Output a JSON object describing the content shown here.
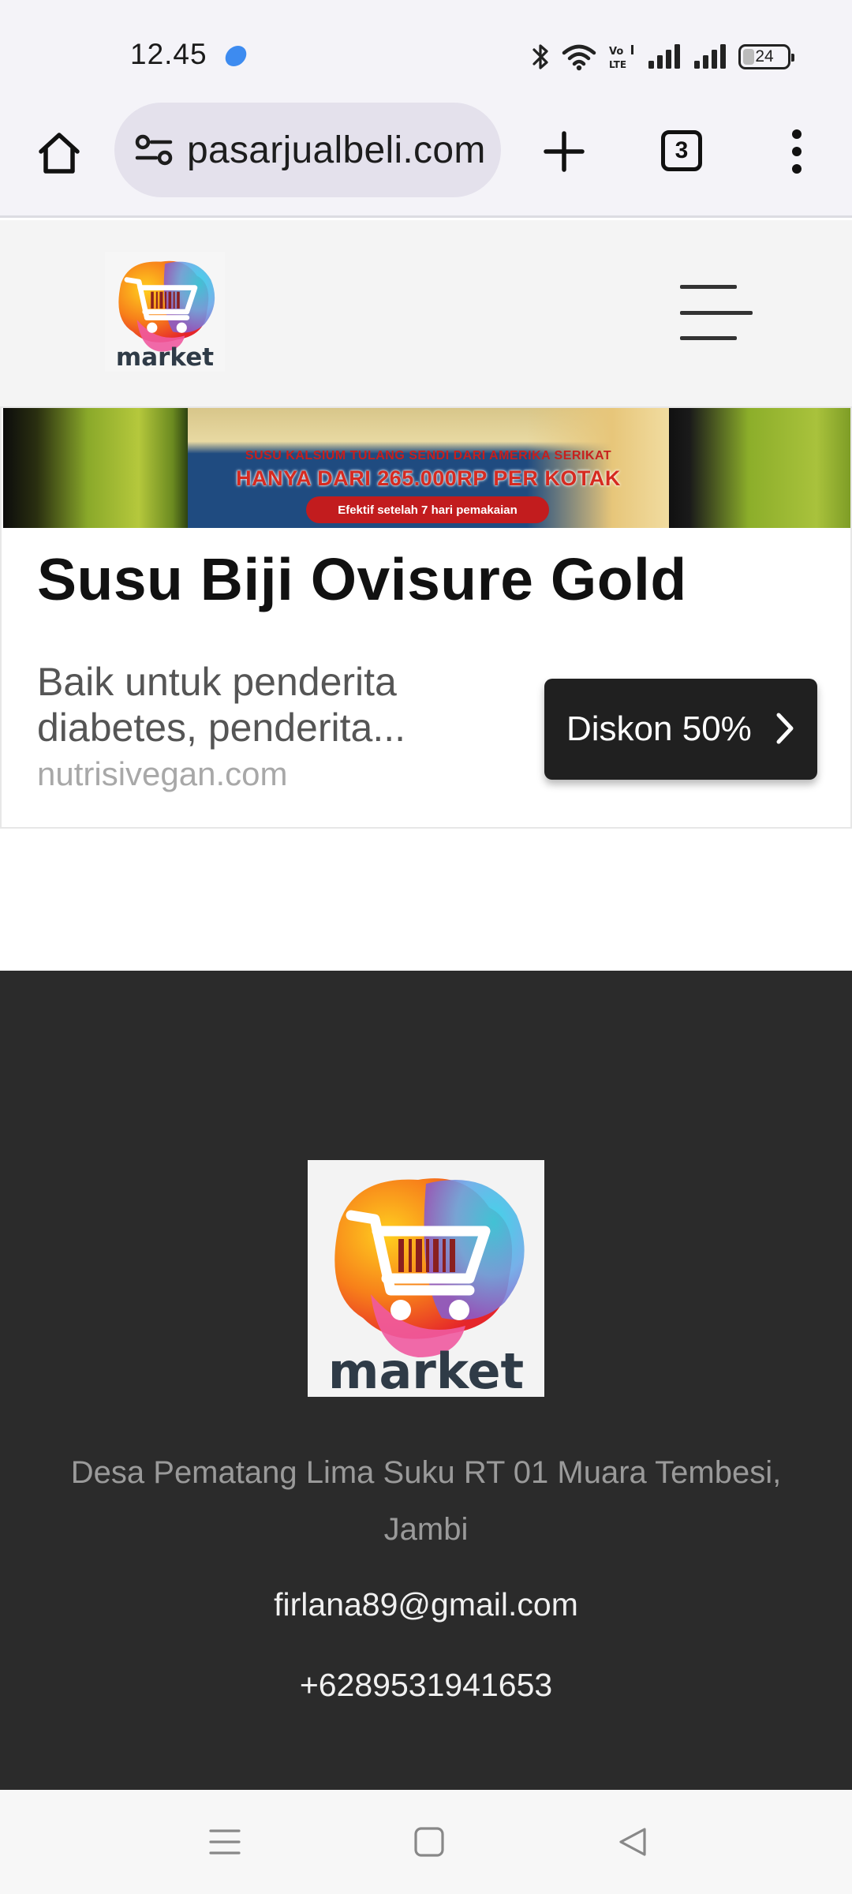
{
  "status_bar": {
    "time": "12.45",
    "battery_level": "24",
    "icons": [
      "bluetooth-icon",
      "wifi-icon",
      "volte-icon",
      "signal-icon",
      "signal-icon",
      "battery-icon"
    ]
  },
  "browser": {
    "url": "pasarjualbeli.com",
    "tab_count": "3",
    "icons": [
      "home-icon",
      "site-settings-icon",
      "new-tab-icon",
      "tabs-icon",
      "more-menu-icon"
    ]
  },
  "site_header": {
    "logo_label": "market",
    "menu_icon": "hamburger-icon"
  },
  "ad": {
    "banner_line1": "SUSU KALSIUM TULANG SENDI DARI AMERIKA SERIKAT",
    "banner_line2": "HANYA DARI 265.000RP PER KOTAK",
    "banner_pill": "Efektif setelah 7 hari pemakaian",
    "title": "Susu Biji Ovisure Gold",
    "description": "Baik untuk penderita diabetes, penderita...",
    "domain": "nutrisivegan.com",
    "cta_label": "Diskon 50%"
  },
  "footer": {
    "logo_label": "market",
    "address": "Desa Pematang Lima Suku RT 01 Muara Tembesi, Jambi",
    "email": "firlana89@gmail.com",
    "phone": "+6289531941653"
  },
  "nav_bar": {
    "icons": [
      "recents-icon",
      "home-icon",
      "back-icon"
    ]
  },
  "colors": {
    "footer_bg": "#2b2b2b",
    "cta_bg": "#202020",
    "browser_bg": "#f4f3f8",
    "url_pill": "#e4e1ec"
  }
}
